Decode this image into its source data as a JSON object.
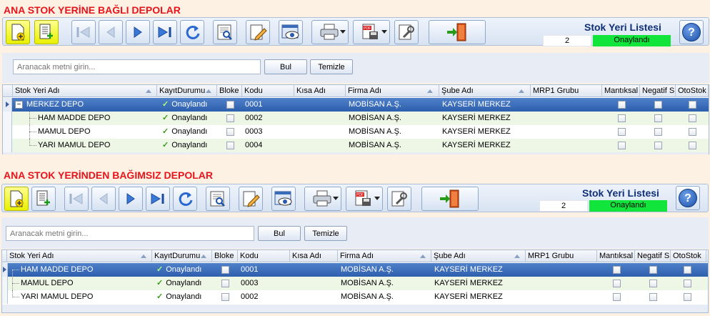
{
  "sections": [
    {
      "title": "ANA STOK YERİNE BAĞLI DEPOLAR",
      "list_title": "Stok Yeri Listesi",
      "count": "2",
      "status": "Onaylandı",
      "search_placeholder": "Aranacak metni girin...",
      "find_label": "Bul",
      "clear_label": "Temizle",
      "columns": [
        "Stok Yeri Adı",
        "KayıtDurumu",
        "Bloke",
        "Kodu",
        "Kısa Adı",
        "Firma Adı",
        "Şube Adı",
        "MRP1 Grubu",
        "Mantıksal",
        "Negatif S",
        "OtoStok"
      ],
      "rows": [
        {
          "name": "MERKEZ DEPO",
          "status": "Onaylandı",
          "code": "0001",
          "company": "MOBİSAN A.Ş.",
          "branch": "KAYSERİ MERKEZ",
          "selected": true
        },
        {
          "name": "HAM MADDE DEPO",
          "status": "Onaylandı",
          "code": "0002",
          "company": "MOBİSAN A.Ş.",
          "branch": "KAYSERİ MERKEZ"
        },
        {
          "name": "MAMUL DEPO",
          "status": "Onaylandı",
          "code": "0003",
          "company": "MOBİSAN A.Ş.",
          "branch": "KAYSERİ MERKEZ"
        },
        {
          "name": "YARI MAMUL DEPO",
          "status": "Onaylandı",
          "code": "0004",
          "company": "MOBİSAN A.Ş.",
          "branch": "KAYSERİ MERKEZ"
        }
      ]
    },
    {
      "title": "ANA STOK YERİNDEN BAĞIMSIZ DEPOLAR",
      "list_title": "Stok Yeri Listesi",
      "count": "2",
      "status": "Onaylandı",
      "search_placeholder": "Aranacak metni girin...",
      "find_label": "Bul",
      "clear_label": "Temizle",
      "columns": [
        "Stok Yeri Adı",
        "KayıtDurumu",
        "Bloke",
        "Kodu",
        "Kısa Adı",
        "Firma Adı",
        "Şube Adı",
        "MRP1 Grubu",
        "Mantıksal",
        "Negatif S",
        "OtoStok"
      ],
      "rows": [
        {
          "name": "HAM MADDE DEPO",
          "status": "Onaylandı",
          "code": "0001",
          "company": "MOBİSAN A.Ş.",
          "branch": "KAYSERİ MERKEZ",
          "selected": true
        },
        {
          "name": "MAMUL DEPO",
          "status": "Onaylandı",
          "code": "0003",
          "company": "MOBİSAN A.Ş.",
          "branch": "KAYSERİ MERKEZ"
        },
        {
          "name": "YARI MAMUL DEPO",
          "status": "Onaylandı",
          "code": "0002",
          "company": "MOBİSAN A.Ş.",
          "branch": "KAYSERİ MERKEZ"
        }
      ]
    }
  ],
  "toolbar_icons": [
    "new-document-icon",
    "new-subitem-icon",
    "first-record-icon",
    "previous-record-icon",
    "next-record-icon",
    "last-record-icon",
    "refresh-icon",
    "preview-icon",
    "edit-icon",
    "view-icon",
    "print-icon",
    "export-pdf-icon",
    "settings-icon",
    "exit-icon",
    "help-icon"
  ],
  "colors": {
    "title_red": "#e8141b",
    "list_title_blue": "#0f2f78",
    "status_green": "#11e43b",
    "selected_row": "#3a6bb8",
    "highlight_yellow": "#e8f000"
  }
}
